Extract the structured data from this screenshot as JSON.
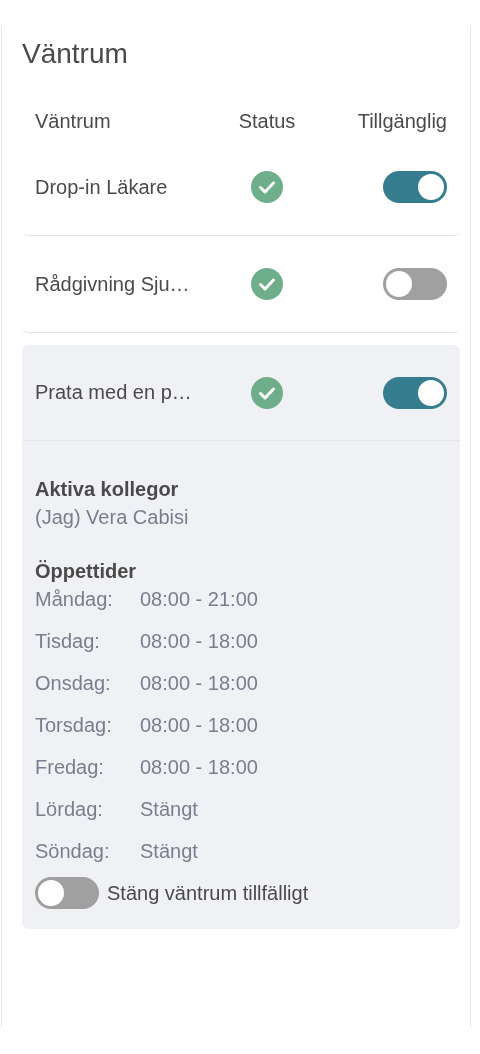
{
  "title": "Väntrum",
  "columns": [
    "Väntrum",
    "Status",
    "Tillgänglig"
  ],
  "rooms": [
    {
      "name": "Drop-in Läkare",
      "status_ok": true,
      "available": true,
      "expanded": false
    },
    {
      "name": "Rådgivning Sju…",
      "status_ok": true,
      "available": false,
      "expanded": false
    },
    {
      "name": "Prata med en p…",
      "status_ok": true,
      "available": true,
      "expanded": true,
      "details": {
        "colleagues_heading": "Aktiva kollegor",
        "colleagues": [
          "(Jag) Vera Cabisi"
        ],
        "hours_heading": "Öppettider",
        "hours": [
          {
            "day": "Måndag:",
            "time": "08:00 - 21:00"
          },
          {
            "day": "Tisdag:",
            "time": "08:00 - 18:00"
          },
          {
            "day": "Onsdag:",
            "time": "08:00 - 18:00"
          },
          {
            "day": "Torsdag:",
            "time": "08:00 - 18:00"
          },
          {
            "day": "Fredag:",
            "time": "08:00 - 18:00"
          },
          {
            "day": "Lördag:",
            "time": "Stängt"
          },
          {
            "day": "Söndag:",
            "time": "Stängt"
          }
        ],
        "close_toggle": {
          "label": "Stäng väntrum tillfälligt",
          "on": false
        }
      }
    }
  ]
}
